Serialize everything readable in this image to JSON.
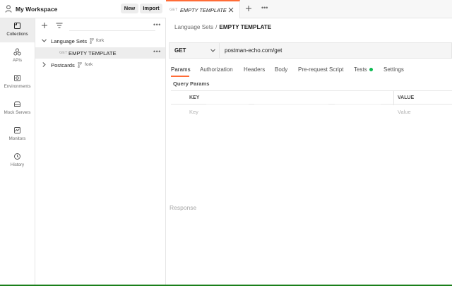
{
  "workspace": {
    "name": "My Workspace",
    "new_label": "New",
    "import_label": "Import"
  },
  "rail": {
    "items": [
      {
        "label": "Collections",
        "icon": "collections-icon",
        "active": true
      },
      {
        "label": "APIs",
        "icon": "apis-icon",
        "active": false
      },
      {
        "label": "Environments",
        "icon": "environments-icon",
        "active": false
      },
      {
        "label": "Mock Servers",
        "icon": "mock-servers-icon",
        "active": false
      },
      {
        "label": "Monitors",
        "icon": "monitors-icon",
        "active": false
      },
      {
        "label": "History",
        "icon": "history-icon",
        "active": false
      }
    ]
  },
  "sidebar": {
    "more_label": "•••",
    "collections": [
      {
        "name": "Language Sets",
        "fork_label": "fork",
        "expanded": true,
        "requests": [
          {
            "method": "GET",
            "name": "EMPTY TEMPLATE",
            "selected": true,
            "more_label": "•••"
          }
        ]
      },
      {
        "name": "Postcards",
        "fork_label": "fork",
        "expanded": false,
        "requests": []
      }
    ]
  },
  "tabs": {
    "active": {
      "method": "GET",
      "title": "EMPTY TEMPLATE"
    },
    "more_label": "•••"
  },
  "breadcrumb": {
    "parent": "Language Sets",
    "separator": "/",
    "current": "EMPTY TEMPLATE"
  },
  "request": {
    "method": "GET",
    "url": "postman-echo.com/get",
    "tabs": [
      "Params",
      "Authorization",
      "Headers",
      "Body",
      "Pre-request Script",
      "Tests",
      "Settings"
    ],
    "active_tab": "Params",
    "tests_indicator_color": "#0cbb52"
  },
  "params": {
    "title": "Query Params",
    "columns": {
      "key": "KEY",
      "value": "VALUE"
    },
    "placeholders": {
      "key": "Key",
      "value": "Value"
    }
  },
  "response": {
    "label": "Response"
  },
  "colors": {
    "accent": "#ff6c37",
    "status_bar": "#1a7f1a"
  }
}
